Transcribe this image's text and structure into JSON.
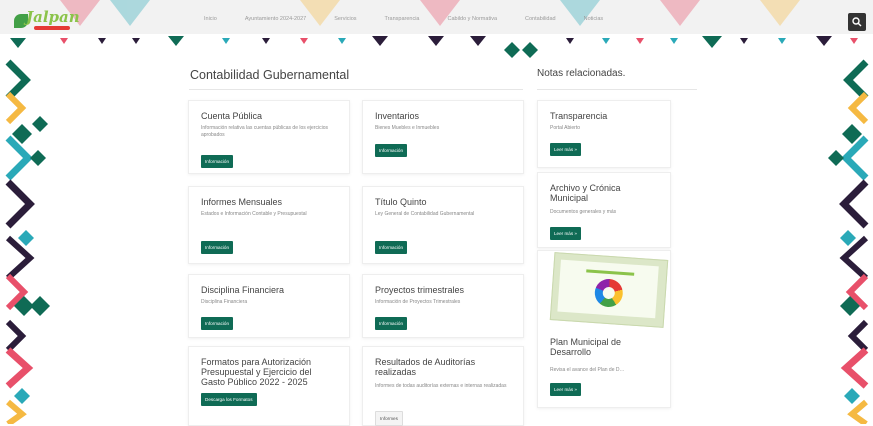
{
  "nav": {
    "logo_text": "Jalpan",
    "items": [
      "Inicio",
      "Ayuntamiento 2024-2027",
      "Servicios",
      "Transparencia",
      "Cabildo y Normativa",
      "Contabilidad",
      "Noticias"
    ],
    "search_placeholder": ""
  },
  "main": {
    "title": "Contabilidad Gubernamental",
    "cards": [
      {
        "title": "Cuenta Pública",
        "desc": "Información relativa las cuentas públicas de los ejercicios aprobados",
        "button": "Información"
      },
      {
        "title": "Inventarios",
        "desc": "Bienes Muebles e Inmuebles",
        "button": "Información"
      },
      {
        "title": "Informes Mensuales",
        "desc": "Estados e Información Contable y Presupuestal",
        "button": "Información"
      },
      {
        "title": "Título Quinto",
        "desc": "Ley General de Contabilidad Gubernamental",
        "button": "Información"
      },
      {
        "title": "Disciplina Financiera",
        "desc": "Disciplina Financiera",
        "button": "Información"
      },
      {
        "title": "Proyectos trimestrales",
        "desc": "Información de Proyectos Trimestrales",
        "button": "Información"
      },
      {
        "title": "Formatos para Autorización Presupuestal y Ejercicio del Gasto Público 2022 - 2025",
        "desc": "",
        "button": "Descarga los Formatos"
      },
      {
        "title": "Resultados de Auditorías realizadas",
        "desc": "Informes de todas auditorías externas e internas realizadas",
        "button": "Informes"
      }
    ]
  },
  "sidebar": {
    "title": "Notas relacionadas.",
    "cards": [
      {
        "title": "Transparencia",
        "desc": "Portal Abierto",
        "button": "Leer más »"
      },
      {
        "title": "Archivo y Crónica Municipal",
        "desc": "Documentos generales y más",
        "button": "Leer más »"
      },
      {
        "title": "Plan Municipal de Desarrollo",
        "desc": "Revisa el avance del Plan de D…",
        "button": "Leer más »"
      }
    ]
  },
  "colors": {
    "primary": "#0f6b55",
    "accent_red": "#e8506a",
    "accent_yellow": "#f5b942",
    "accent_teal": "#2aa9b8",
    "dark": "#2b1d3a"
  }
}
